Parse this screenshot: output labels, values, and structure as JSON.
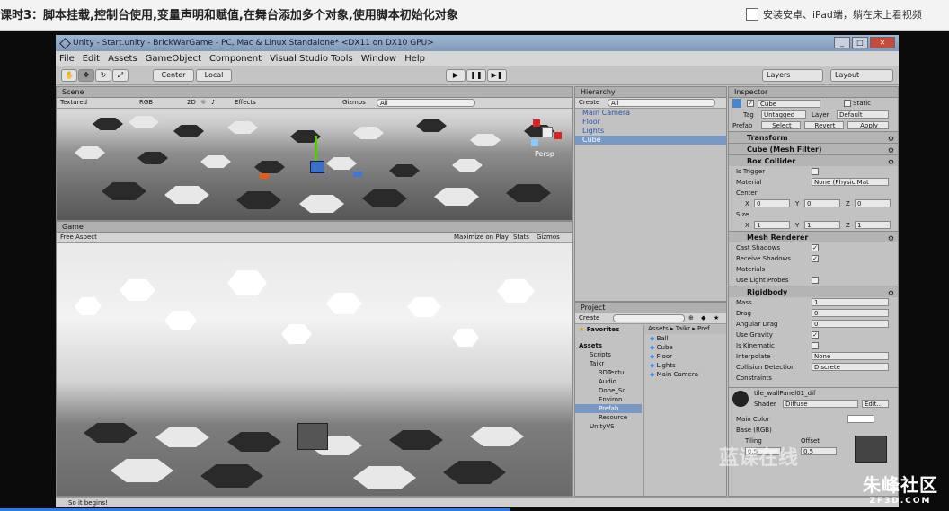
{
  "page": {
    "lesson_title": "课时3：脚本挂载,控制台使用,变量声明和赋值,在舞台添加多个对象,使用脚本初始化对象",
    "promo_text": "安装安卓、iPad端，躺在床上看视频"
  },
  "unity": {
    "window_title": "Unity - Start.unity - BrickWarGame - PC, Mac & Linux Standalone* <DX11 on DX10 GPU>",
    "menu": [
      "File",
      "Edit",
      "Assets",
      "GameObject",
      "Component",
      "Visual Studio Tools",
      "Window",
      "Help"
    ],
    "toolbar": {
      "center_label": "Center",
      "local_label": "Local",
      "layers_label": "Layers",
      "layout_label": "Layout"
    },
    "scene": {
      "tab_label": "Scene",
      "render_mode": "Textured",
      "color_mode": "RGB",
      "mode_2d": "2D",
      "effects_label": "Effects",
      "gizmos_label": "Gizmos",
      "search_placeholder": "All",
      "persp_label": "Persp"
    },
    "game": {
      "tab_label": "Game",
      "aspect": "Free Aspect",
      "maximize_label": "Maximize on Play",
      "stats_label": "Stats",
      "gizmos_label": "Gizmos"
    },
    "hierarchy": {
      "tab_label": "Hierarchy",
      "create_label": "Create",
      "search_placeholder": "All",
      "items": [
        "Main Camera",
        "Floor",
        "Lights",
        "Cube"
      ],
      "selected": "Cube"
    },
    "project": {
      "tab_label": "Project",
      "create_label": "Create",
      "favorites_label": "Favorites",
      "breadcrumb": "Assets ▸ Taikr ▸ Pref",
      "tree": [
        "Assets",
        "Scripts",
        "Taikr",
        "3DTextu",
        "Audio",
        "Done_Sc",
        "Environ",
        "Prefab",
        "Resource",
        "UnityVS"
      ],
      "files": [
        "Ball",
        "Cube",
        "Floor",
        "Lights",
        "Main Camera"
      ]
    },
    "inspector": {
      "tab_label": "Inspector",
      "object_name": "Cube",
      "static_label": "Static",
      "tag_label": "Tag",
      "tag_value": "Untagged",
      "layer_label": "Layer",
      "layer_value": "Default",
      "prefab_label": "Prefab",
      "prefab_select": "Select",
      "prefab_revert": "Revert",
      "prefab_apply": "Apply",
      "transform_label": "Transform",
      "mesh_filter_label": "Cube (Mesh Filter)",
      "box_collider_label": "Box Collider",
      "is_trigger_label": "Is Trigger",
      "material_label": "Material",
      "material_value": "None (Physic Mat",
      "center_label": "Center",
      "center": [
        "0",
        "0",
        "0"
      ],
      "size_label": "Size",
      "size": [
        "1",
        "1",
        "1"
      ],
      "mesh_renderer_label": "Mesh Renderer",
      "cast_shadows_label": "Cast Shadows",
      "receive_shadows_label": "Receive Shadows",
      "materials_label": "Materials",
      "use_light_probes_label": "Use Light Probes",
      "rigidbody_label": "Rigidbody",
      "mass_label": "Mass",
      "mass_value": "1",
      "drag_label": "Drag",
      "drag_value": "0",
      "angular_drag_label": "Angular Drag",
      "angular_drag_value": "0",
      "use_gravity_label": "Use Gravity",
      "is_kinematic_label": "Is Kinematic",
      "interpolate_label": "Interpolate",
      "interpolate_value": "None",
      "collision_label": "Collision Detection",
      "collision_value": "Discrete",
      "constraints_label": "Constraints",
      "shader_material_name": "tile_wallPanel01_dif",
      "shader_label": "Shader",
      "shader_value": "Diffuse",
      "shader_edit": "Edit...",
      "main_color_label": "Main Color",
      "base_label": "Base (RGB)",
      "tiling_label": "Tiling",
      "offset_label": "Offset",
      "tiling_value": "0.5",
      "offset_value": "0.5"
    },
    "status_text": "So it begins!"
  },
  "overlay": {
    "watermark": "蓝课在线",
    "logo_big": "朱峰社区",
    "logo_small": "ZF3D.COM"
  },
  "colors": {
    "accent": "#2a7de1",
    "selection": "#7899c4"
  }
}
